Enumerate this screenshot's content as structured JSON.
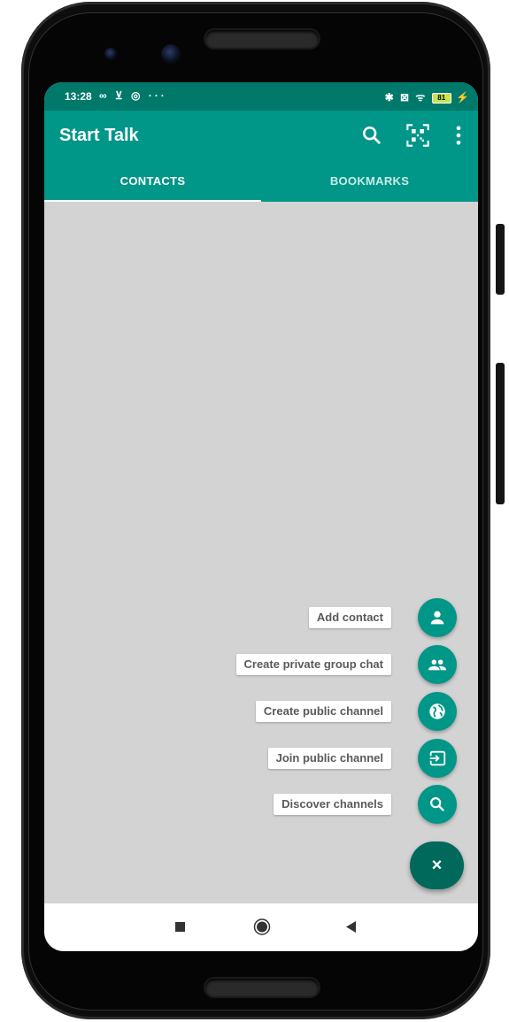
{
  "statusbar": {
    "time": "13:28",
    "left_icons": "∞ ⊻ ◎ ···",
    "right_icons": "✱ ⊠ ᯤ",
    "battery": "81"
  },
  "app": {
    "title": "Start Talk"
  },
  "toolbar": {
    "icons": [
      "search-icon",
      "qr-code-scan-icon",
      "more-vert-icon"
    ]
  },
  "tabs": [
    {
      "label": "CONTACTS",
      "active": true
    },
    {
      "label": "BOOKMARKS",
      "active": false
    }
  ],
  "fab_menu": {
    "items": [
      {
        "label": "Add contact",
        "icon": "person-icon"
      },
      {
        "label": "Create private group chat",
        "icon": "group-icon"
      },
      {
        "label": "Create public channel",
        "icon": "globe-icon"
      },
      {
        "label": "Join public channel",
        "icon": "input-icon"
      },
      {
        "label": "Discover channels",
        "icon": "search-icon"
      }
    ],
    "close_label": "×"
  },
  "navbar": {
    "icons": [
      "recents-square-icon",
      "home-circle-icon",
      "back-triangle-icon"
    ]
  },
  "colors": {
    "primary": "#009688",
    "primary_dark": "#00796b",
    "fab_dark": "#00695c",
    "background": "#d3d3d3"
  }
}
